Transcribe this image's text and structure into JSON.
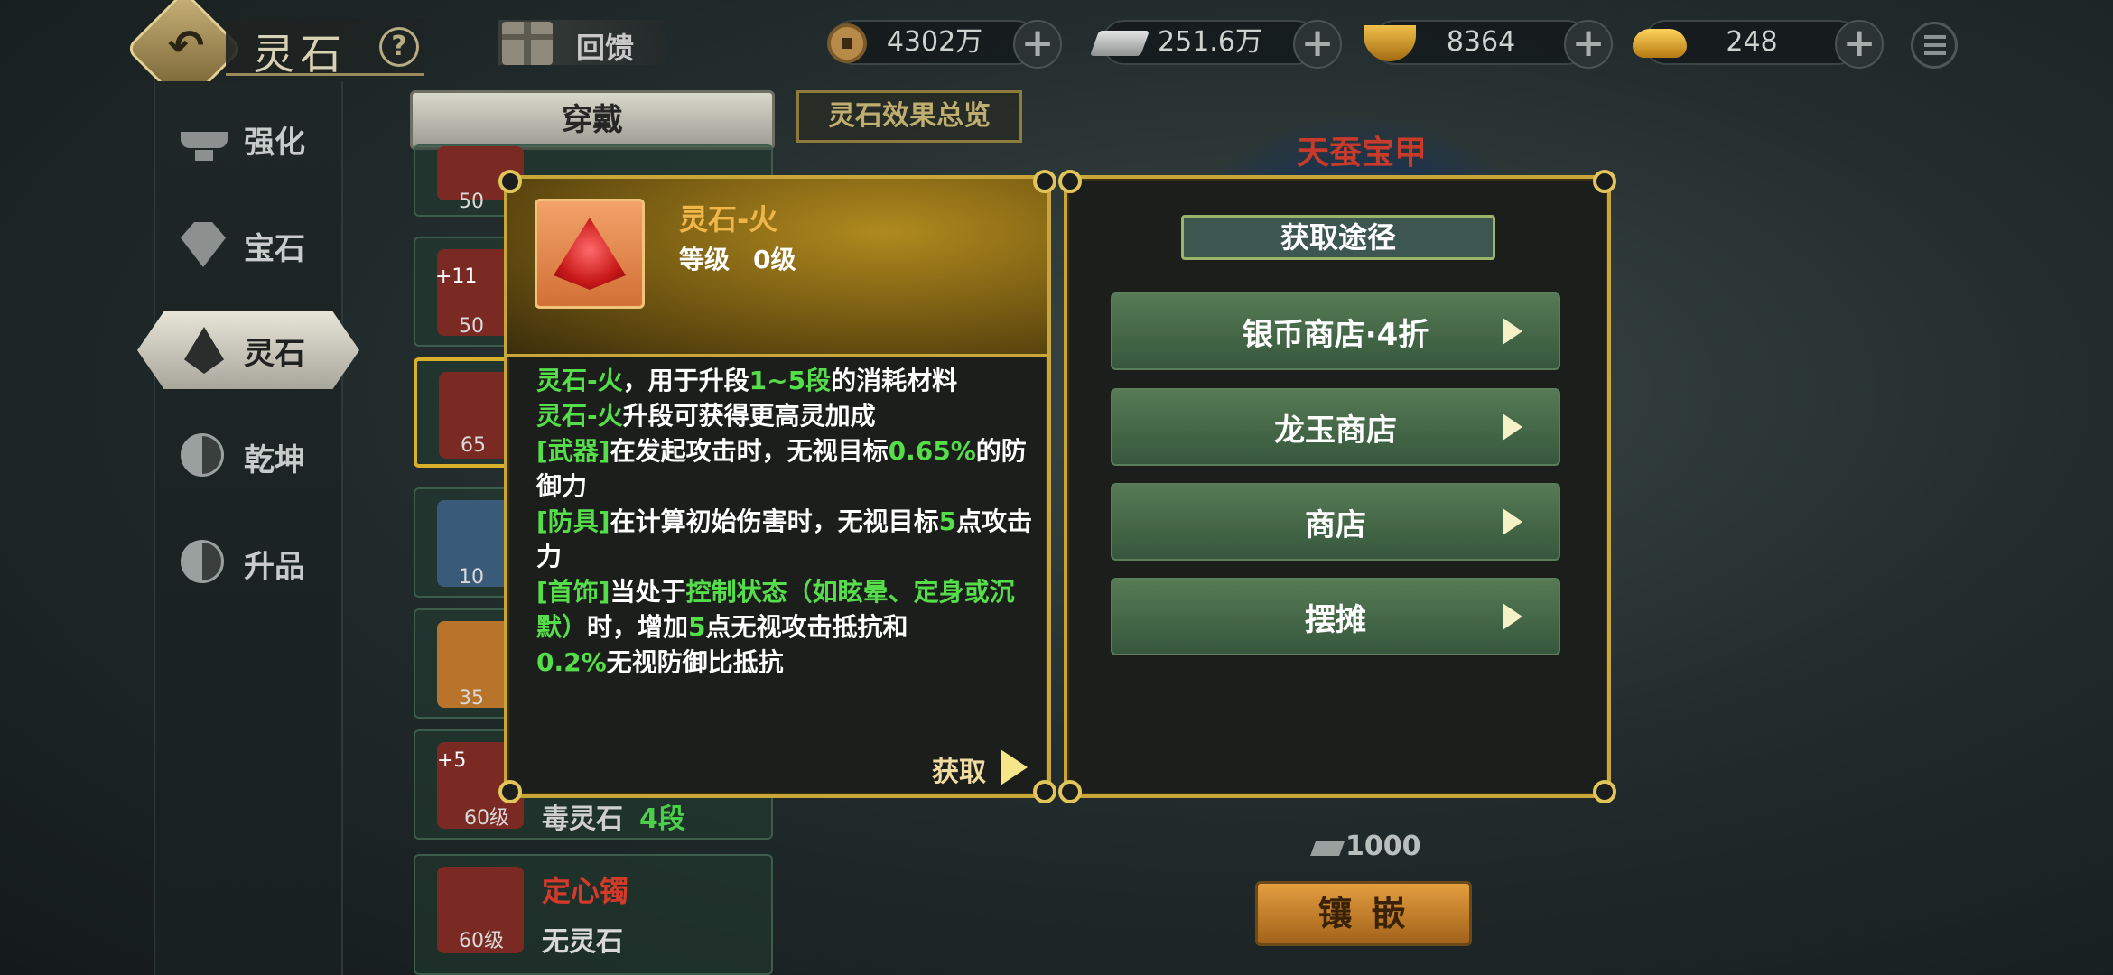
{
  "header": {
    "title": "灵石",
    "help": "?",
    "gift_label": "回馈"
  },
  "currencies": [
    {
      "icon": "copper-coin-icon",
      "value": "4302万"
    },
    {
      "icon": "silver-ingot-icon",
      "value": "251.6万"
    },
    {
      "icon": "gold-ingot-bowl-icon",
      "value": "8364"
    },
    {
      "icon": "gold-yuanbao-icon",
      "value": "248"
    }
  ],
  "sidebar": {
    "items": [
      {
        "label": "强化",
        "icon": "anvil-icon"
      },
      {
        "label": "宝石",
        "icon": "gem-icon"
      },
      {
        "label": "灵石",
        "icon": "spirit-stone-icon",
        "active": true
      },
      {
        "label": "乾坤",
        "icon": "yin-yang-icon"
      },
      {
        "label": "升品",
        "icon": "yin-yang-icon"
      }
    ]
  },
  "tabs": {
    "wear": "穿戴",
    "overview": "灵石效果总览"
  },
  "equip_list": [
    {
      "level": "50"
    },
    {
      "plus": "+11",
      "level": "50"
    },
    {
      "level": "65"
    },
    {
      "level": "10"
    },
    {
      "level": "35"
    },
    {
      "plus": "+5",
      "level": "60级",
      "name": "毒灵石",
      "stage": "4段"
    },
    {
      "level": "60级",
      "name": "定心镯",
      "status": "无灵石"
    }
  ],
  "right_bg": {
    "title": "天蚕宝甲",
    "cost": "1000",
    "inlay": "镶 嵌"
  },
  "tooltip": {
    "name": "灵石-火",
    "level_label": "等级",
    "level_value": "0级",
    "lines": {
      "l1a": "灵石-火",
      "l1b": "，用于升段",
      "l1c": "1~5段",
      "l1d": "的消耗材料",
      "l2a": "灵石-火",
      "l2b": "升段可获得更高灵加成",
      "l3a": "[武器]",
      "l3b": "在发起攻击时，无视目标",
      "l3c": "0.65%",
      "l3d": "的防御力",
      "l4a": "[防具]",
      "l4b": "在计算初始伤害时，无视目标",
      "l4c": "5",
      "l4d": "点攻击力",
      "l5a": "[首饰]",
      "l5b": "当处于",
      "l5c": "控制状态（如眩晕、定身或沉默）",
      "l5d": "时，增加",
      "l5e": "5",
      "l5f": "点无视攻击抵抗和",
      "l6a": "0.2%",
      "l6b": "无视防御比抵抗"
    },
    "get_label": "获取"
  },
  "sources": {
    "title": "获取途径",
    "items": [
      {
        "label": "银币商店·4折"
      },
      {
        "label": "龙玉商店"
      },
      {
        "label": "商店"
      },
      {
        "label": "摆摊"
      }
    ]
  },
  "colors": {
    "accent_gold": "#c8a63a",
    "highlight_green": "#55dd4a",
    "item_name": "#f0b64a"
  }
}
